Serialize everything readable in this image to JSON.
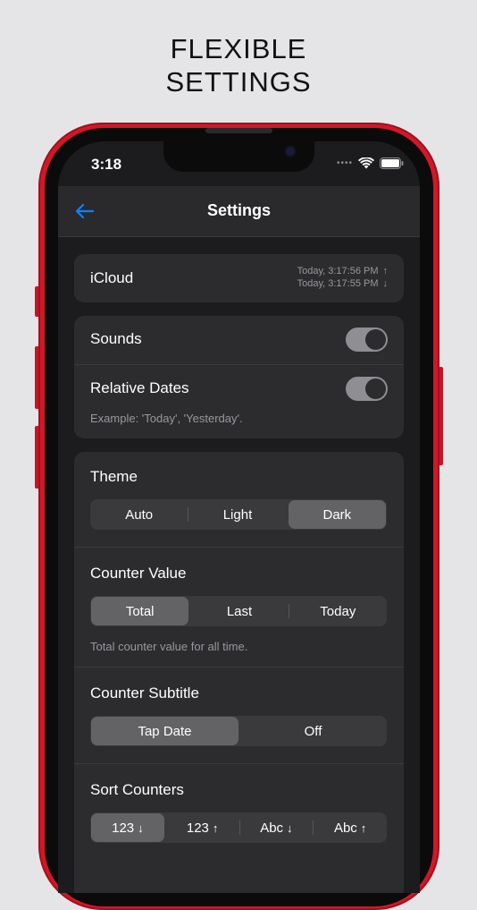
{
  "headline": {
    "line1": "FLEXIBLE",
    "line2": "SETTINGS"
  },
  "status_bar": {
    "time": "3:18"
  },
  "nav": {
    "title": "Settings"
  },
  "icloud": {
    "label": "iCloud",
    "upload_time": "Today, 3:17:56 PM",
    "download_time": "Today, 3:17:55 PM"
  },
  "sounds": {
    "label": "Sounds",
    "enabled": true
  },
  "relative_dates": {
    "label": "Relative Dates",
    "enabled": true,
    "example": "Example: 'Today', 'Yesterday'."
  },
  "theme": {
    "label": "Theme",
    "options": [
      "Auto",
      "Light",
      "Dark"
    ],
    "selected": "Dark"
  },
  "counter_value": {
    "label": "Counter Value",
    "options": [
      "Total",
      "Last",
      "Today"
    ],
    "selected": "Total",
    "description": "Total counter value for all time."
  },
  "counter_subtitle": {
    "label": "Counter Subtitle",
    "options": [
      "Tap Date",
      "Off"
    ],
    "selected": "Tap Date"
  },
  "sort_counters": {
    "label": "Sort Counters",
    "options": [
      "123",
      "123",
      "Abc",
      "Abc"
    ],
    "arrows": [
      "↓",
      "↑",
      "↓",
      "↑"
    ],
    "selected_index": 0
  },
  "colors": {
    "accent": "#0a84ff",
    "frame": "#d01828",
    "background": "#1c1c1e",
    "card": "#2c2c2e"
  }
}
